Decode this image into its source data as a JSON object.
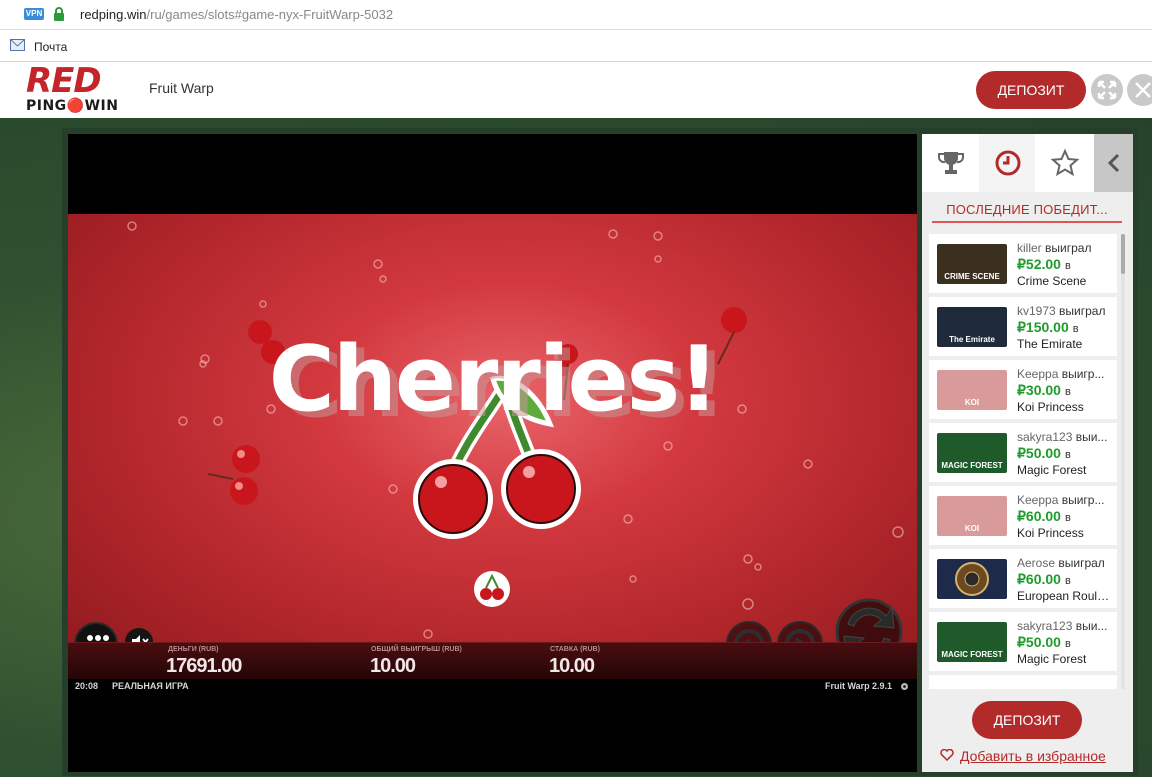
{
  "browser": {
    "vpn_badge": "VPN",
    "url_domain": "redping.win",
    "url_path": "/ru/games/slots#game-nyx-FruitWarp-5032",
    "bookmark_label": "Почта"
  },
  "header": {
    "logo_top": "RED",
    "logo_bottom": "PING🔴WIN",
    "game_title": "Fruit Warp",
    "deposit_label": "ДЕПОЗИТ",
    "fullscreen_icon": "expand-icon",
    "close_icon": "close-icon"
  },
  "game": {
    "banner": "Cherries!",
    "labels": {
      "money": "ДЕНЬГИ (RUB)",
      "total_win": "ОБЩИЙ ВЫИГРЫШ (RUB)",
      "bet": "СТАВКА (RUB)"
    },
    "values": {
      "money": "17691.00",
      "total_win": "10.00",
      "bet": "10.00"
    },
    "footer": {
      "time": "20:08",
      "mode": "РЕАЛЬНАЯ ИГРА",
      "name": "Fruit Warp",
      "version": "2.9.1"
    }
  },
  "panel": {
    "tabs": [
      "trophy-icon",
      "clock-icon",
      "star-icon",
      "chevron-left-icon"
    ],
    "active_tab": 1,
    "winners_title": "ПОСЛЕДНИЕ ПОБЕДИТ...",
    "in_word": "в",
    "items": [
      {
        "user": "killer",
        "verb": "выиграл",
        "amount": "₽52.00",
        "game": "Crime Scene",
        "thumb_color": "#3b2f1f",
        "thumb_text": "CRIME SCENE"
      },
      {
        "user": "kv1973",
        "verb": "выиграл",
        "amount": "₽150.00",
        "game": "The Emirate",
        "thumb_color": "#1f2b3b",
        "thumb_text": "The Emirate"
      },
      {
        "user": "Keeppa",
        "verb": "выигр...",
        "amount": "₽30.00",
        "game": "Koi Princess",
        "thumb_color": "#d99a9a",
        "thumb_text": "KOI"
      },
      {
        "user": "sakyra123",
        "verb": "выи...",
        "amount": "₽50.00",
        "game": "Magic Forest",
        "thumb_color": "#1f5a2a",
        "thumb_text": "MAGIC FOREST"
      },
      {
        "user": "Keeppa",
        "verb": "выигр...",
        "amount": "₽60.00",
        "game": "Koi Princess",
        "thumb_color": "#d99a9a",
        "thumb_text": "KOI"
      },
      {
        "user": "Aerose",
        "verb": "выиграл",
        "amount": "₽60.00",
        "game": "European Roule...",
        "thumb_color": "#1d2a4a",
        "thumb_text": ""
      },
      {
        "user": "sakyra123",
        "verb": "выи...",
        "amount": "₽50.00",
        "game": "Magic Forest",
        "thumb_color": "#1f5a2a",
        "thumb_text": "MAGIC FOREST"
      }
    ],
    "deposit_label": "ДЕПОЗИТ",
    "favorite_label": "Добавить в избранное",
    "favorite_icon": "heart-icon"
  }
}
